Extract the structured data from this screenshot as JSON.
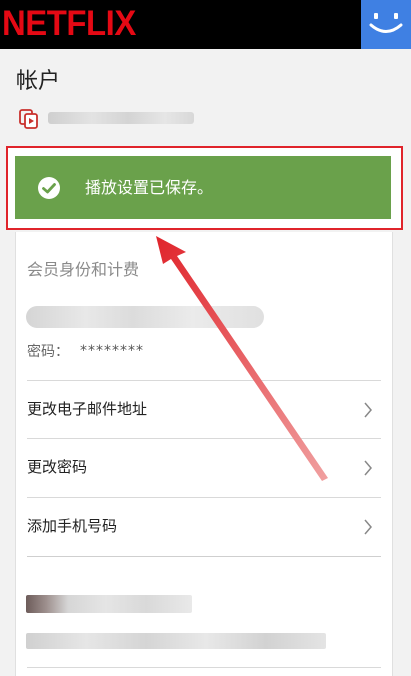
{
  "header": {
    "logo_text": "NETFLIX",
    "logo_color": "#e50914"
  },
  "page": {
    "title": "帐户"
  },
  "toast": {
    "message": "播放设置已保存。",
    "color": "#6aa14b"
  },
  "membership": {
    "heading": "会员身份和计费",
    "password_label": "密码：",
    "password_value": "********"
  },
  "rows": [
    {
      "label": "更改电子邮件地址"
    },
    {
      "label": "更改密码"
    },
    {
      "label": "添加手机号码"
    }
  ],
  "annotation": {
    "highlight_color": "#e0242b"
  }
}
